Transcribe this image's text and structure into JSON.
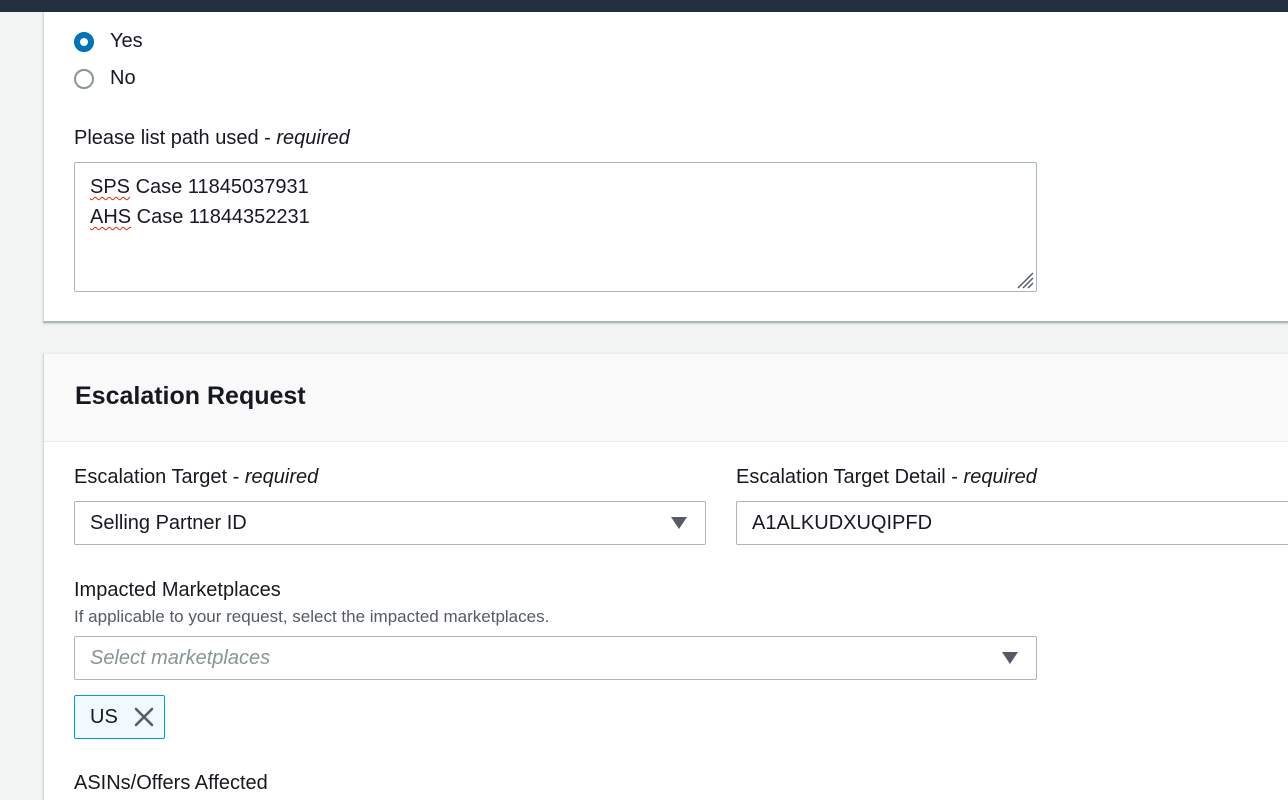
{
  "top_question": {
    "options": [
      {
        "label": "Yes",
        "selected": true
      },
      {
        "label": "No",
        "selected": false
      }
    ]
  },
  "path_field": {
    "label": "Please list path used",
    "required_suffix": "required",
    "lines": [
      {
        "prefix": "SPS",
        "rest": " Case 11845037931"
      },
      {
        "prefix": "AHS",
        "rest": " Case 11844352231"
      }
    ]
  },
  "escalation_section": {
    "title": "Escalation Request"
  },
  "escalation_target": {
    "label": "Escalation Target",
    "required_suffix": "required",
    "value": "Selling Partner ID"
  },
  "escalation_target_detail": {
    "label": "Escalation Target Detail",
    "required_suffix": "required",
    "value": "A1ALKUDXUQIPFD"
  },
  "impacted_marketplaces": {
    "label": "Impacted Marketplaces",
    "description": "If applicable to your request, select the impacted marketplaces.",
    "placeholder": "Select marketplaces",
    "tokens": [
      {
        "label": "US"
      }
    ]
  },
  "asins_field": {
    "label": "ASINs/Offers Affected"
  },
  "colors": {
    "accent": "#0073bb",
    "topbar": "#232f3e",
    "token_border": "#00a1c9",
    "token_bg": "#f1faff"
  }
}
